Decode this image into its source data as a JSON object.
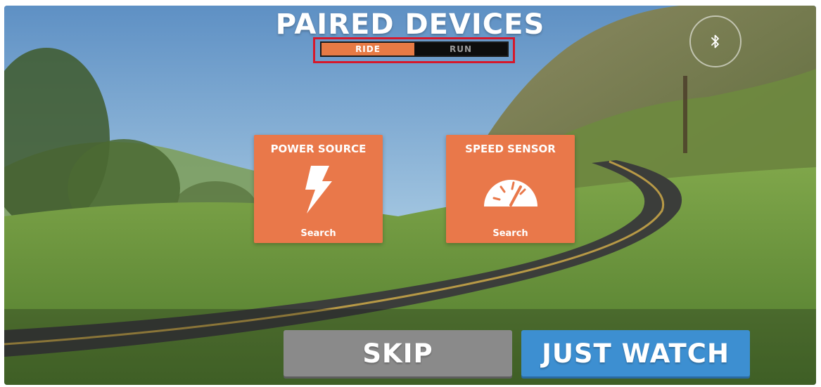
{
  "header": {
    "title": "PAIRED DEVICES"
  },
  "mode_toggle": {
    "tabs": [
      {
        "label": "RIDE",
        "active": true
      },
      {
        "label": "RUN",
        "active": false
      }
    ],
    "highlight_color": "#d6182b"
  },
  "bluetooth": {
    "icon": "bluetooth-icon"
  },
  "devices": [
    {
      "title": "POWER SOURCE",
      "icon": "lightning-bolt-icon",
      "action": "Search"
    },
    {
      "title": "SPEED SENSOR",
      "icon": "speedometer-icon",
      "action": "Search"
    }
  ],
  "actions": {
    "skip_label": "SKIP",
    "watch_label": "JUST WATCH"
  },
  "colors": {
    "card": "#e9784a",
    "active_tab": "#e67a45",
    "skip": "#8a8a8a",
    "watch": "#3d8fd1"
  }
}
